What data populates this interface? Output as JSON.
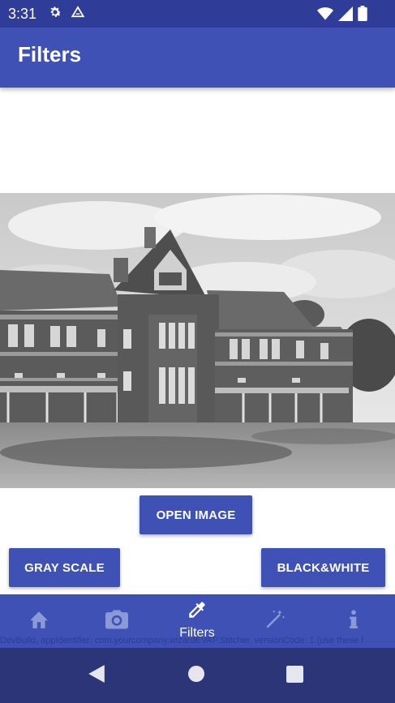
{
  "status_bar": {
    "time": "3:31",
    "icons": [
      "gear-icon",
      "drive-icon",
      "wifi-icon",
      "signal-icon",
      "battery-icon"
    ]
  },
  "app_bar": {
    "title": "Filters"
  },
  "image": {
    "description_icon": "building-photo"
  },
  "buttons": {
    "open_image": "OPEN IMAGE",
    "gray_scale": "GRAY SCALE",
    "black_white": "BLACK&WHITE"
  },
  "bottom_nav": {
    "items": [
      {
        "icon": "home-icon",
        "label": ""
      },
      {
        "icon": "camera-icon",
        "label": ""
      },
      {
        "icon": "eyedropper-icon",
        "label": "Filters"
      },
      {
        "icon": "magic-wand-icon",
        "label": ""
      },
      {
        "icon": "info-icon",
        "label": ""
      }
    ],
    "active_index": 2
  },
  "watermark": "DevBuild, appIdentifier: com.yourcompany.wizardEVAP.Stitcher, versionCode: 1 (use these f",
  "colors": {
    "primary": "#3f51b5",
    "primary_dark": "#2f3d99",
    "inactive_icon": "#8c99d9",
    "nav_bar": "#2b3577"
  }
}
